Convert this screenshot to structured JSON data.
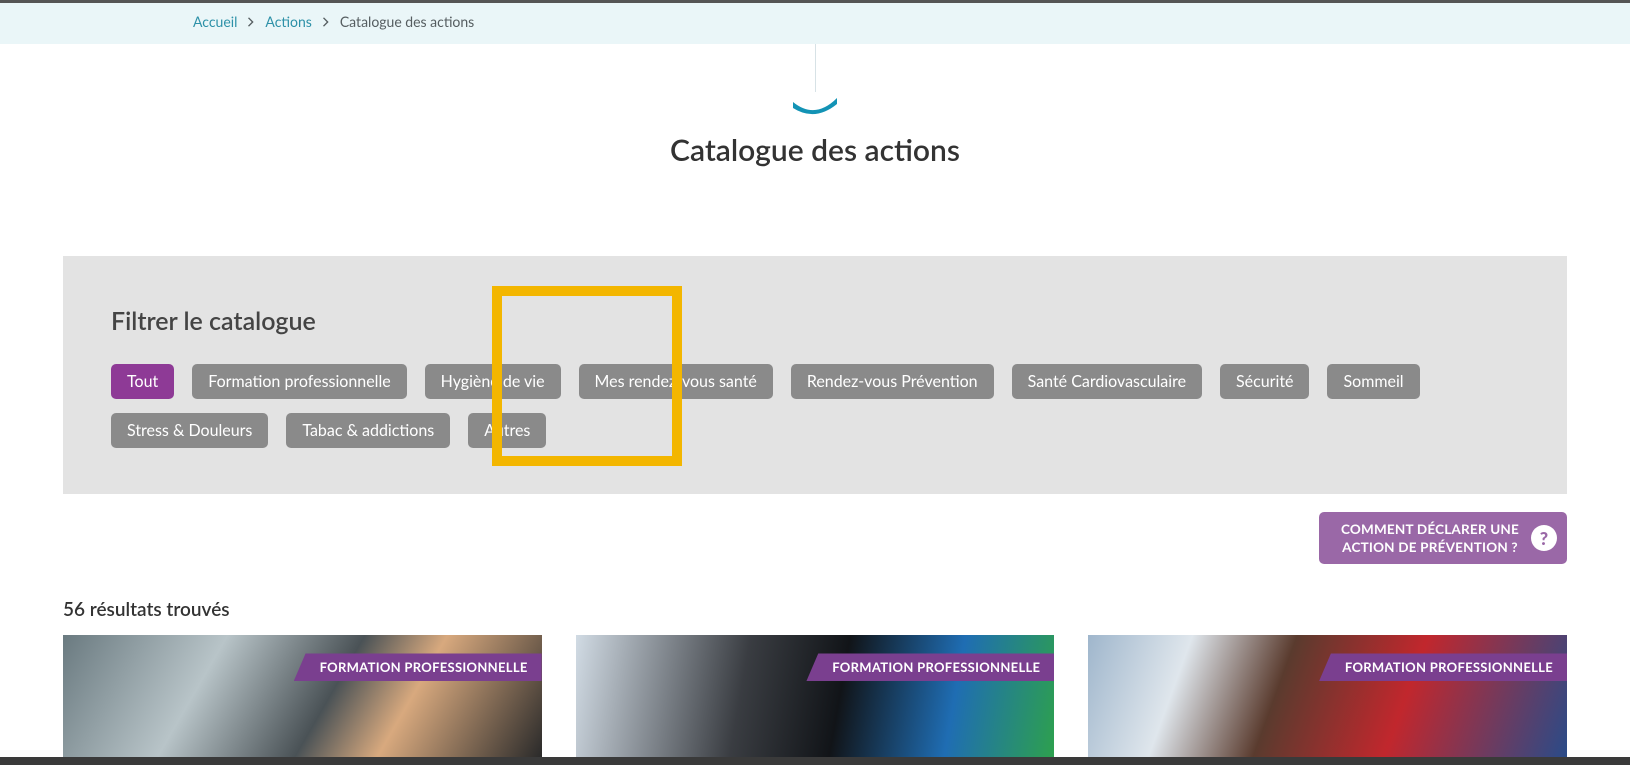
{
  "breadcrumb": {
    "items": [
      {
        "label": "Accueil",
        "link": true
      },
      {
        "label": "Actions",
        "link": true
      },
      {
        "label": "Catalogue des actions",
        "link": false
      }
    ]
  },
  "page": {
    "title": "Catalogue des actions"
  },
  "filter": {
    "title": "Filtrer le catalogue",
    "chips": [
      {
        "label": "Tout",
        "active": true
      },
      {
        "label": "Formation professionnelle",
        "active": false
      },
      {
        "label": "Hygiène de vie",
        "active": false
      },
      {
        "label": "Mes rendez-vous santé",
        "active": false
      },
      {
        "label": "Rendez-vous Prévention",
        "active": false
      },
      {
        "label": "Santé Cardiovasculaire",
        "active": false
      },
      {
        "label": "Sécurité",
        "active": false
      },
      {
        "label": "Sommeil",
        "active": false
      },
      {
        "label": "Stress & Douleurs",
        "active": false
      },
      {
        "label": "Tabac & addictions",
        "active": false
      },
      {
        "label": "Autres",
        "active": false
      }
    ]
  },
  "cta": {
    "line1": "COMMENT DÉCLARER UNE",
    "line2": "ACTION DE PRÉVENTION ?"
  },
  "results": {
    "text": "56 résultats trouvés"
  },
  "cards": [
    {
      "tag": "FORMATION PROFESSIONNELLE"
    },
    {
      "tag": "FORMATION PROFESSIONNELLE"
    },
    {
      "tag": "FORMATION PROFESSIONNELLE"
    }
  ],
  "colors": {
    "accent_teal": "#2d91a8",
    "accent_purple": "#8e3a96",
    "chip_gray": "#8a8a8a",
    "cta_purple": "#9a68a7",
    "highlight_yellow": "#f3b600"
  }
}
